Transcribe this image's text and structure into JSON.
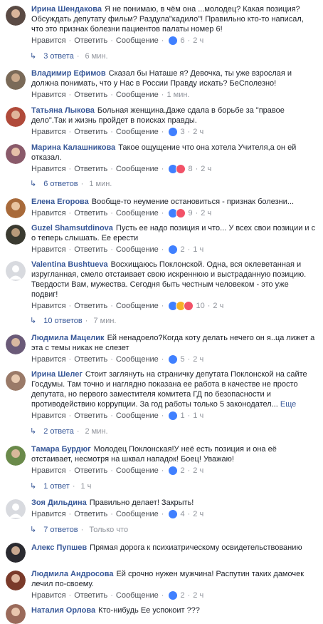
{
  "actions": {
    "like": "Нравится",
    "reply": "Ответить",
    "message": "Сообщение",
    "more": "Еще"
  },
  "comments": [
    {
      "author": "Ирина Шендакова",
      "text": "Я не понимаю, в чём она ...молодец? Какая позиция? Обсуждать депутату фильм? Раздула\"кадило\"! Правильно кто-то написал, что это признак болезни пациентов палаты номер 6!",
      "reactions": [
        "like"
      ],
      "count": "6",
      "time": "2 ч",
      "replies": "3 ответа",
      "replies_time": "6 мин.",
      "avatar_color": "#5a4a44"
    },
    {
      "author": "Владимир Ефимов",
      "text": "Сказал бы Наташе я? Девочка, ты уже взрослая и должна понимать, что у Нас в России Правду искать? БеСполезно!",
      "reactions": [],
      "count": "",
      "time": "1 мин.",
      "avatar_color": "#7a6a58"
    },
    {
      "author": "Татьяна Лыкова",
      "text": "Больная женщина.Даже сдала в борьбе за \"правое дело\".Так и жизнь пройдет в поисках правды.",
      "reactions": [
        "like"
      ],
      "count": "3",
      "time": "2 ч",
      "avatar_color": "#b04a3a"
    },
    {
      "author": "Марина Калашникова",
      "text": "Такое ощущение что она хотела Учителя,а он ей отказал.",
      "reactions": [
        "like",
        "love"
      ],
      "count": "8",
      "time": "2 ч",
      "replies": "6 ответов",
      "replies_time": "1 мин.",
      "avatar_color": "#8a5a6a"
    },
    {
      "author": "Елена Егорова",
      "text": "Вообще-то неумение остановиться - признак болезни...",
      "reactions": [
        "like",
        "love"
      ],
      "count": "9",
      "time": "2 ч",
      "avatar_color": "#a86a3a"
    },
    {
      "author": "Guzel Shamsutdinova",
      "text": "Пусть ее надо позиция и что... У всех свои позиции и с о теперь слышать. Ее ерести",
      "reactions": [
        "like"
      ],
      "count": "2",
      "time": "1 ч",
      "avatar_color": "#3a3a30"
    },
    {
      "author": "Valentina Bushtueva",
      "text": "Восхищаюсь Поклонской. Одна, вся оклеветанная и изругланная, смело отстаивает свою искреннюю и выстраданную позицию. Твердости Вам, мужества. Сегодня быть честным человеком - это уже подвиг!",
      "reactions": [
        "like",
        "haha",
        "love"
      ],
      "count": "10",
      "time": "2 ч",
      "replies": "10 ответов",
      "replies_time": "7 мин.",
      "avatar_color": "#d8dadf"
    },
    {
      "author": "Людмила Мацелик",
      "text": "Ей ненадоело?Когда коту делать нечего он я..ца лижет а эта с темы никак не слезет",
      "reactions": [
        "like"
      ],
      "count": "5",
      "time": "2 ч",
      "avatar_color": "#6a5a78"
    },
    {
      "author": "Ирина Шелег",
      "text": "Стоит заглянуть на страничку депутата Поклонской на сайте Госдумы. Там точно и наглядно показана ее работа в качестве не просто депутата, но первого заместителя комитета ГД по безопасности и противодействию коррупции. За год работы только 5 законодател...",
      "reactions": [
        "like"
      ],
      "count": "1",
      "time": "1 ч",
      "has_more": true,
      "replies": "2 ответа",
      "replies_time": "2 мин.",
      "avatar_color": "#9a7a68"
    },
    {
      "author": "Тамара Бурдюг",
      "text": "Молодец Поклонская!У неё есть позиция и она её отстаивает, несмотря на шквал нападок! Боец! Уважаю!",
      "reactions": [
        "like"
      ],
      "count": "2",
      "time": "2 ч",
      "replies": "1 ответ",
      "replies_time": "1 ч",
      "avatar_color": "#6a8a4a"
    },
    {
      "author": "Зоя Дильдина",
      "text": "Правильно делает! Закрыть!",
      "reactions": [
        "like"
      ],
      "count": "4",
      "time": "2 ч",
      "replies": "7 ответов",
      "replies_time": "Только что",
      "avatar_color": "#d8dadf"
    },
    {
      "author": "Алекс Пупшев",
      "text": "Прямая дорога к психиатрическому освидетельствованию",
      "reactions": [],
      "count": "",
      "time": "",
      "avatar_color": "#2a2a30"
    },
    {
      "author": "Людмила Андросова",
      "text": "Ей срочно нужен мужчина! Распутин таких дамочек лечил по-своему.",
      "reactions": [
        "like"
      ],
      "count": "2",
      "time": "2 ч",
      "avatar_color": "#7a3a2a"
    },
    {
      "author": "Наталия Орлова",
      "text": "Кто-нибудь Ее успокоит ???",
      "reactions": [],
      "count": "",
      "time": "",
      "avatar_color": "#9a6a5a"
    }
  ]
}
